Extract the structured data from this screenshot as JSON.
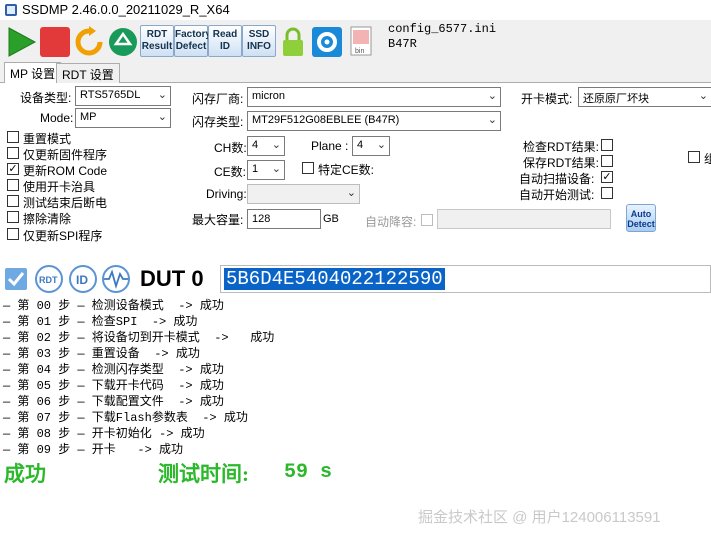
{
  "window": {
    "title": "SSDMP 2.46.0.0_20211029_R_X64"
  },
  "toolbar": {
    "buttons": [
      {
        "name": "start",
        "icon": "play-icon",
        "color": "#2aa02a"
      },
      {
        "name": "stop",
        "icon": "stop-icon",
        "color": "#e23a3a"
      },
      {
        "name": "refresh",
        "icon": "refresh-icon",
        "color": "#f0a000"
      },
      {
        "name": "recycle",
        "icon": "recycle-icon",
        "color": "#1a9a5a"
      }
    ],
    "rdt_result": [
      "RDT",
      "Result"
    ],
    "factory_defect": [
      "Factory",
      "Defect"
    ],
    "read_id": [
      "Read",
      "ID"
    ],
    "ssd_info": [
      "SSD",
      "INFO"
    ],
    "lock_icon": "lock-icon",
    "settings_icon": "gear-icon",
    "bin_label": "bin"
  },
  "config": {
    "file": "config_6577.ini",
    "flash": "B47R"
  },
  "tabs": {
    "mp": "MP 设置",
    "rdt": "RDT 设置"
  },
  "form": {
    "device_type_label": "设备类型:",
    "device_type_value": "RTS5765DL",
    "mode_label": "Mode:",
    "mode_value": "MP",
    "flash_vendor_label": "闪存厂商:",
    "flash_vendor_value": "micron",
    "flash_type_label": "闪存类型:",
    "flash_type_value": "MT29F512G08EBLEE (B47R)",
    "ch_label": "CH数:",
    "ch_value": "4",
    "plane_label": "Plane :",
    "plane_value": "4",
    "ce_label": "CE数:",
    "ce_value": "1",
    "specific_ce_label": "特定CE数:",
    "driving_label": "Driving:",
    "driving_value": "",
    "max_capacity_label": "最大容量:",
    "max_capacity_value": "128",
    "gb_label": "GB",
    "auto_downcap_label": "自动降容:",
    "open_mode_label": "开卡模式:",
    "open_mode_value": "还原原厂坏块",
    "check_rdt_label": "检查RDT结果:",
    "save_rdt_label": "保存RDT结果:",
    "auto_scan_label": "自动扫描设备:",
    "auto_start_label": "自动开始测试:",
    "cut_label": "组"
  },
  "checkboxes": [
    {
      "label": "重置模式",
      "checked": false
    },
    {
      "label": "仅更新固件程序",
      "checked": false
    },
    {
      "label": "更新ROM Code",
      "checked": true
    },
    {
      "label": "使用开卡治具",
      "checked": false
    },
    {
      "label": "测试结束后断电",
      "checked": false
    },
    {
      "label": "擦除清除",
      "checked": false
    },
    {
      "label": "仅更新SPI程序",
      "checked": false
    }
  ],
  "right_checks": {
    "check_rdt": false,
    "save_rdt": false,
    "auto_scan": true,
    "auto_start": false
  },
  "auto_detect": [
    "Auto",
    "Detect"
  ],
  "dut": {
    "label": "DUT 0",
    "serial": "5B6D4E5404022122590",
    "icons": [
      "checkbox-icon",
      "rdt-icon",
      "id-icon",
      "waveform-icon"
    ],
    "rdt_text": "RDT",
    "id_text": "ID"
  },
  "steps": [
    "— 第 00 步 — 检测设备模式  -> 成功",
    "— 第 01 步 — 检查SPI  -> 成功",
    "— 第 02 步 — 将设备切到开卡模式  ->   成功",
    "— 第 03 步 — 重置设备  -> 成功",
    "— 第 04 步 — 检测闪存类型  -> 成功",
    "— 第 05 步 — 下载开卡代码  -> 成功",
    "— 第 06 步 — 下载配置文件  -> 成功",
    "— 第 07 步 — 下载Flash参数表  -> 成功",
    "— 第 08 步 — 开卡初始化 -> 成功",
    "— 第 09 步 — 开卡   -> 成功"
  ],
  "result": {
    "status": "成功",
    "test_time_label": "测试时间:",
    "test_time_value": "59 s"
  },
  "watermark": "掘金技术社区 @ 用户124006113591"
}
